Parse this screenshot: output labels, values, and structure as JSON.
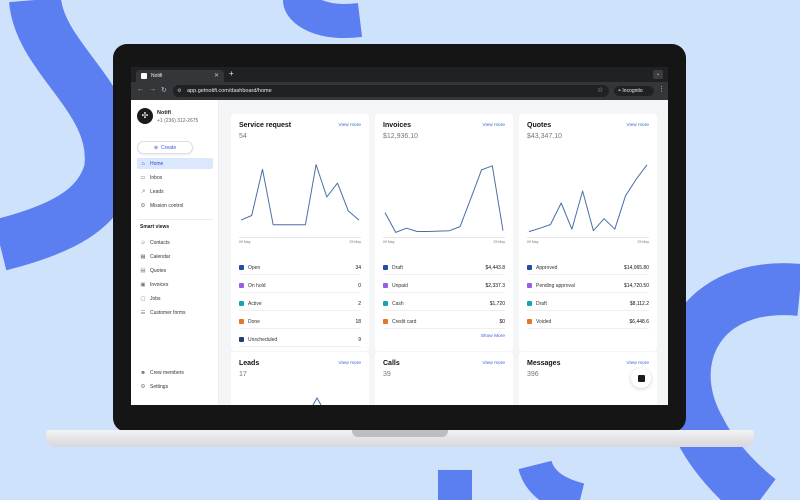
{
  "browser": {
    "tab_title": "Notifi",
    "url": "app.getnotifi.com/dashboard/home",
    "profile_label": "Incognito"
  },
  "sidebar": {
    "org_name": "Notifi",
    "org_phone": "+1 (236) 312-2675",
    "create_label": "Create",
    "nav": [
      {
        "label": "Home",
        "icon": "home-icon"
      },
      {
        "label": "Inbox",
        "icon": "inbox-icon"
      },
      {
        "label": "Leads",
        "icon": "leads-icon"
      },
      {
        "label": "Mission control",
        "icon": "mission-control-icon"
      }
    ],
    "smart_views_heading": "Smart views",
    "smart_views": [
      {
        "label": "Contacts",
        "icon": "contacts-icon"
      },
      {
        "label": "Calendar",
        "icon": "calendar-icon"
      },
      {
        "label": "Quotes",
        "icon": "quotes-icon"
      },
      {
        "label": "Invoices",
        "icon": "invoices-icon"
      },
      {
        "label": "Jobs",
        "icon": "jobs-icon"
      },
      {
        "label": "Customer forms",
        "icon": "customer-forms-icon"
      }
    ],
    "bottom": [
      {
        "label": "Crew members",
        "icon": "crew-members-icon"
      },
      {
        "label": "Settings",
        "icon": "settings-icon"
      }
    ]
  },
  "cards": {
    "service_request": {
      "title": "Service request",
      "link": "View more",
      "total": "54",
      "axis_start": "09 May",
      "axis_end": "25 May",
      "legend": [
        {
          "label": "Open",
          "value": "34",
          "color": "#1f4fa8"
        },
        {
          "label": "On hold",
          "value": "0",
          "color": "#9b5de5"
        },
        {
          "label": "Active",
          "value": "2",
          "color": "#1f9fb4"
        },
        {
          "label": "Done",
          "value": "18",
          "color": "#e8742b"
        },
        {
          "label": "Unscheduled",
          "value": "9",
          "color": "#1c3f7a"
        }
      ]
    },
    "invoices": {
      "title": "Invoices",
      "link": "View more",
      "total": "$12,936.10",
      "axis_start": "09 May",
      "axis_end": "25 May",
      "legend": [
        {
          "label": "Draft",
          "value": "$4,443.8",
          "color": "#1f4fa8"
        },
        {
          "label": "Unpaid",
          "value": "$2,337.3",
          "color": "#9b5de5"
        },
        {
          "label": "Cash",
          "value": "$1,720",
          "color": "#1f9fb4"
        },
        {
          "label": "Credit card",
          "value": "$0",
          "color": "#e8742b"
        }
      ],
      "show_more": "Show More"
    },
    "quotes": {
      "title": "Quotes",
      "link": "View more",
      "total": "$43,347.10",
      "axis_start": "09 May",
      "axis_end": "25 May",
      "legend": [
        {
          "label": "Approved",
          "value": "$14,065.80",
          "color": "#1f4fa8"
        },
        {
          "label": "Pending approval",
          "value": "$14,720.50",
          "color": "#9b5de5"
        },
        {
          "label": "Draft",
          "value": "$8,112.2",
          "color": "#1f9fb4"
        },
        {
          "label": "Voided",
          "value": "$6,448.6",
          "color": "#e8742b"
        }
      ]
    },
    "leads": {
      "title": "Leads",
      "link": "View more",
      "total": "17"
    },
    "calls": {
      "title": "Calls",
      "link": "View more",
      "total": "39"
    },
    "messages": {
      "title": "Messages",
      "link": "View more",
      "total": "396"
    }
  },
  "chart_data": [
    {
      "type": "line",
      "title": "Service request",
      "x": [
        "09 May",
        "",
        "",
        "",
        "",
        "",
        "",
        "",
        "",
        "",
        "",
        "25 May"
      ],
      "values": [
        3,
        4,
        14,
        2,
        2,
        2,
        2,
        15,
        8,
        11,
        5,
        3
      ],
      "ylim": [
        0,
        16
      ],
      "color": "#4a6fa5"
    },
    {
      "type": "line",
      "title": "Invoices",
      "x": [
        "09 May",
        "",
        "",
        "",
        "",
        "",
        "",
        "",
        "",
        "",
        "",
        "25 May"
      ],
      "values": [
        2600,
        200,
        700,
        300,
        300,
        350,
        400,
        900,
        4300,
        7800,
        8300,
        400
      ],
      "ylim": [
        0,
        9000
      ],
      "color": "#4a6fa5"
    },
    {
      "type": "line",
      "title": "Quotes",
      "x": [
        "09 May",
        "",
        "",
        "",
        "",
        "",
        "",
        "",
        "",
        "",
        "",
        "25 May"
      ],
      "values": [
        500,
        1200,
        2000,
        6500,
        1000,
        9000,
        700,
        3200,
        1000,
        8000,
        11500,
        14500
      ],
      "ylim": [
        0,
        15500
      ],
      "color": "#4a6fa5"
    }
  ]
}
